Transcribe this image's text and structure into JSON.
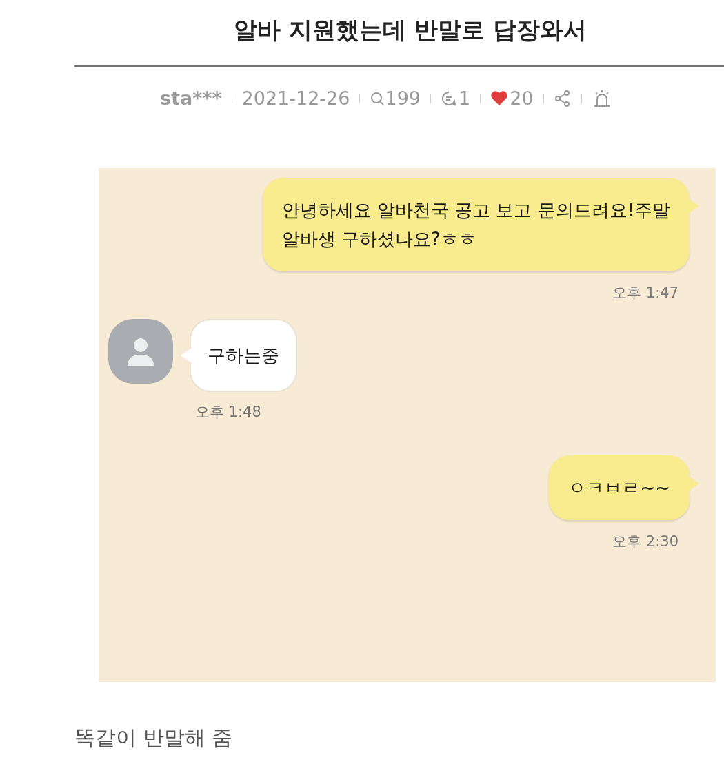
{
  "post": {
    "title": "알바 지원했는데 반말로 답장와서",
    "author": "sta***",
    "date": "2021-12-26",
    "views": "199",
    "comments": "1",
    "likes": "20"
  },
  "chat": {
    "messages": [
      {
        "kind": "sent",
        "lines": [
          "안녕하세요 알바천국 공고 보고 문의드려요!주말",
          "알바생 구하셨나요?ㅎㅎ"
        ],
        "time": "오후 1:47"
      },
      {
        "kind": "received",
        "lines": [
          "구하는중"
        ],
        "time": "오후 1:48"
      },
      {
        "kind": "sent",
        "lines": [
          "ㅇㅋㅂㄹ~~"
        ],
        "time": "오후 2:30"
      }
    ]
  },
  "caption": "똑같이 반말해 줌"
}
